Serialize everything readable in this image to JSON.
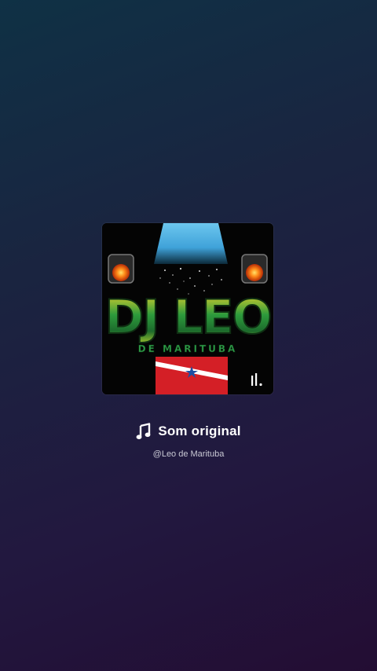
{
  "sound": {
    "title": "Som original",
    "author": "@Leo de Marituba",
    "icon": "music-note-icon"
  },
  "cover": {
    "logo_text": "DJ LEO",
    "logo_subtext": "DE MARITUBA",
    "badge_icon": "sound-bars-icon"
  }
}
